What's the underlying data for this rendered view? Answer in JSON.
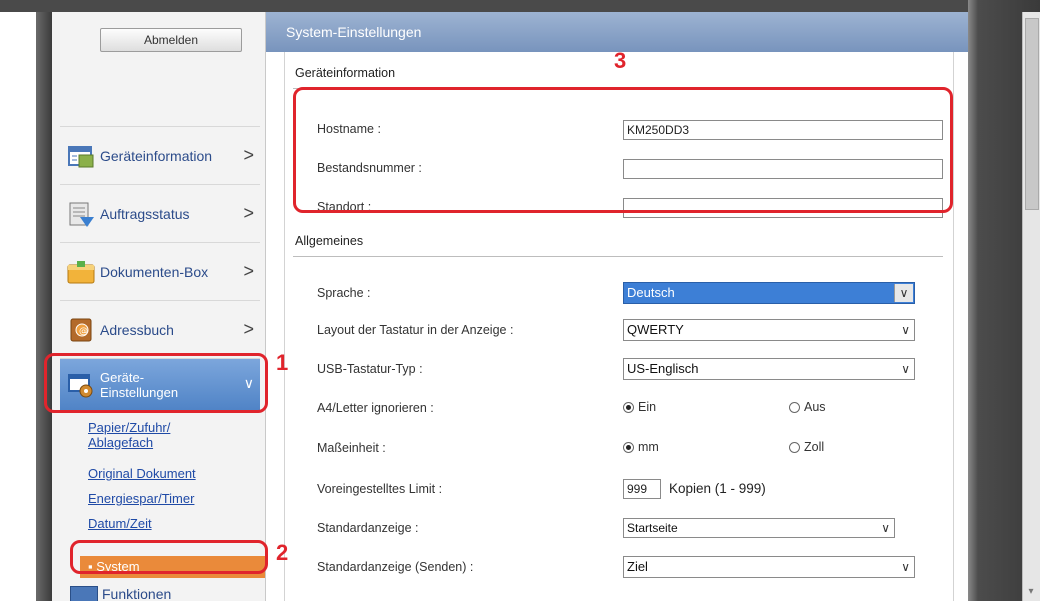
{
  "sidebar": {
    "logout_label": "Abmelden",
    "items": [
      {
        "label": "Geräteinformation",
        "icon": "device-info-icon"
      },
      {
        "label": "Auftragsstatus",
        "icon": "job-status-icon"
      },
      {
        "label": "Dokumenten-Box",
        "icon": "document-box-icon"
      },
      {
        "label": "Adressbuch",
        "icon": "address-book-icon"
      },
      {
        "label_line1": "Geräte-",
        "label_line2": "Einstellungen",
        "icon": "device-settings-icon"
      }
    ],
    "chevron": ">",
    "subitems": [
      "Papier/Zufuhr/",
      "Ablagefach",
      "Original Dokument",
      "Energiespar/Timer",
      "Datum/Zeit"
    ],
    "active_subitem": "System",
    "next_item": "Funktionen"
  },
  "main": {
    "header_title": "System-Einstellungen",
    "section_device": "Geräteinformation",
    "hostname_label": "Hostname :",
    "hostname_value": "KM250DD3",
    "asset_label": "Bestandsnummer :",
    "asset_value": "",
    "location_label": "Standort :",
    "location_value": "",
    "section_general": "Allgemeines",
    "language_label": "Sprache :",
    "language_value": "Deutsch",
    "kbd_layout_label": "Layout der Tastatur in der Anzeige :",
    "kbd_layout_value": "QWERTY",
    "usb_kbd_label": "USB-Tastatur-Typ :",
    "usb_kbd_value": "US-Englisch",
    "a4_label": "A4/Letter ignorieren :",
    "a4_on": "Ein",
    "a4_off": "Aus",
    "a4_selected": "Ein",
    "unit_label": "Maßeinheit :",
    "unit_mm": "mm",
    "unit_zoll": "Zoll",
    "unit_selected": "mm",
    "limit_label": "Voreingestelltes Limit :",
    "limit_value": "999",
    "limit_unit": "Kopien (1 - 999)",
    "default_screen_label": "Standardanzeige :",
    "default_screen_value": "Startseite",
    "default_send_label": "Standardanzeige (Senden) :",
    "default_send_value": "Ziel"
  },
  "annotations": {
    "one": "1",
    "two": "2",
    "three": "3",
    "color": "#e0242c"
  },
  "colors": {
    "header": "#7894bd",
    "active_nav": "#4f83c6",
    "active_sub": "#ea8a3a",
    "select_highlight": "#3d7fd6"
  }
}
